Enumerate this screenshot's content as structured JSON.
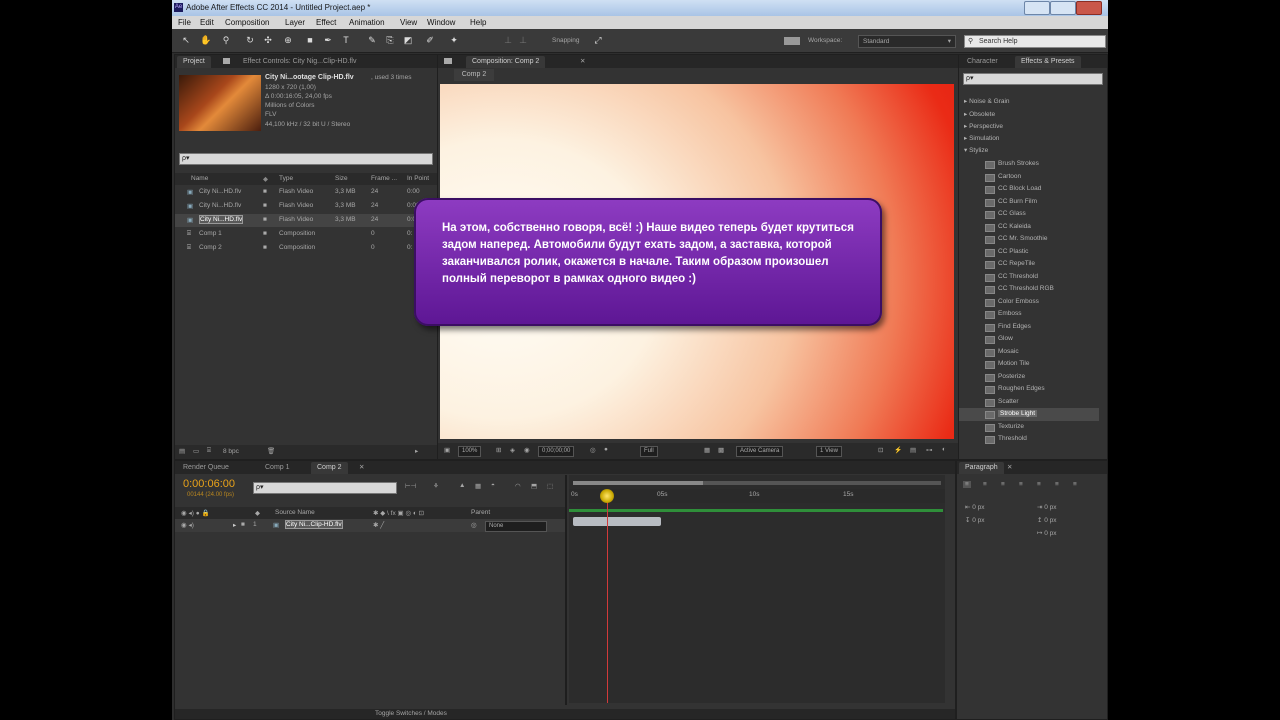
{
  "app": {
    "title": "Adobe After Effects CC 2014 - Untitled Project.aep *",
    "logo_text": "Ae"
  },
  "menu": [
    "File",
    "Edit",
    "Composition",
    "Layer",
    "Effect",
    "Animation",
    "View",
    "Window",
    "Help"
  ],
  "toolbar": {
    "snapping": "Snapping",
    "workspace_label": "Workspace:",
    "workspace_value": "Standard",
    "search_help_placeholder": "Search Help"
  },
  "project_panel": {
    "tabs": [
      "Project",
      "Effect Controls: City Nig...Clip-HD.flv"
    ],
    "footage": {
      "name": "City Ni...ootage Clip-HD.flv",
      "used": ", used 3 times",
      "size": "1280 x 720 (1,00)",
      "duration": "Δ 0:00:16:05, 24,00 fps",
      "colors": "Millions of Colors",
      "format": "FLV",
      "audio": "44,100 kHz / 32 bit U / Stereo"
    },
    "search_placeholder": "ρ▾",
    "columns": [
      "Name",
      "Type",
      "Size",
      "Frame ...",
      "In Point"
    ],
    "items": [
      {
        "name": "City Ni...HD.flv",
        "type": "Flash Video",
        "size": "3,3 MB",
        "fps": "24",
        "in": "0:00"
      },
      {
        "name": "City Ni...HD.flv",
        "type": "Flash Video",
        "size": "3,3 MB",
        "fps": "24",
        "in": "0:00"
      },
      {
        "name": "City Ni...HD.flv",
        "type": "Flash Video",
        "size": "3,3 MB",
        "fps": "24",
        "in": "0:00"
      },
      {
        "name": "Comp 1",
        "type": "Composition",
        "size": "",
        "fps": "0",
        "in": "0:"
      },
      {
        "name": "Comp 2",
        "type": "Composition",
        "size": "",
        "fps": "0",
        "in": "0:"
      }
    ],
    "bpc": "8 bpc"
  },
  "composition_panel": {
    "tab": "Composition: Comp 2",
    "subtab": "Comp 2",
    "controls": {
      "zoom": "100%",
      "timecode": "0;00;00;00",
      "resolution": "Full",
      "camera": "Active Camera",
      "views": "1 View"
    }
  },
  "overlay_text": "На этом, собственно говоря, всё! :) Наше видео теперь будет крутиться задом наперед. Автомобили будут ехать задом, а заставка, которой заканчивался ролик, окажется в начале. Таким образом произошел полный переворот в рамках одного видео :)",
  "right_panel": {
    "tabs": [
      "Character",
      "Effects & Presets"
    ],
    "search_placeholder": "ρ▾",
    "categories": [
      "Noise & Grain",
      "Obsolete",
      "Perspective",
      "Simulation",
      "Stylize"
    ],
    "effects": [
      "Brush Strokes",
      "Cartoon",
      "CC Block Load",
      "CC Burn Film",
      "CC Glass",
      "CC Kaleida",
      "CC Mr. Smoothie",
      "CC Plastic",
      "CC RepeTile",
      "CC Threshold",
      "CC Threshold RGB",
      "Color Emboss",
      "Emboss",
      "Find Edges",
      "Glow",
      "Mosaic",
      "Motion Tile",
      "Posterize",
      "Roughen Edges",
      "Scatter",
      "Strobe Light",
      "Texturize",
      "Threshold"
    ],
    "selected_effect": "Strobe Light"
  },
  "timeline": {
    "tabs": [
      "Render Queue",
      "Comp 1",
      "Comp 2"
    ],
    "timecode": "0:00:06:00",
    "frames": "00144 (24.00 fps)",
    "search_placeholder": "ρ▾",
    "ruler": [
      "0s",
      "05s",
      "10s",
      "15s"
    ],
    "col_source": "Source Name",
    "col_parent": "Parent",
    "layer_number": "1",
    "layer_name": "City Ni...Clip-HD.flv",
    "layer_parent": "None",
    "toggle": "Toggle Switches / Modes",
    "playhead_pct": 10
  },
  "paragraph_panel": {
    "tab": "Paragraph",
    "fields": [
      "0 px",
      "0 px",
      "0 px",
      "0 px",
      "0 px"
    ]
  },
  "colors": {
    "accent_orange": "#e8a21a",
    "playhead": "#d23a3a",
    "callout_top": "#8e3cc2",
    "callout_bottom": "#5d1694",
    "work_bar": "#2f8f3a"
  }
}
